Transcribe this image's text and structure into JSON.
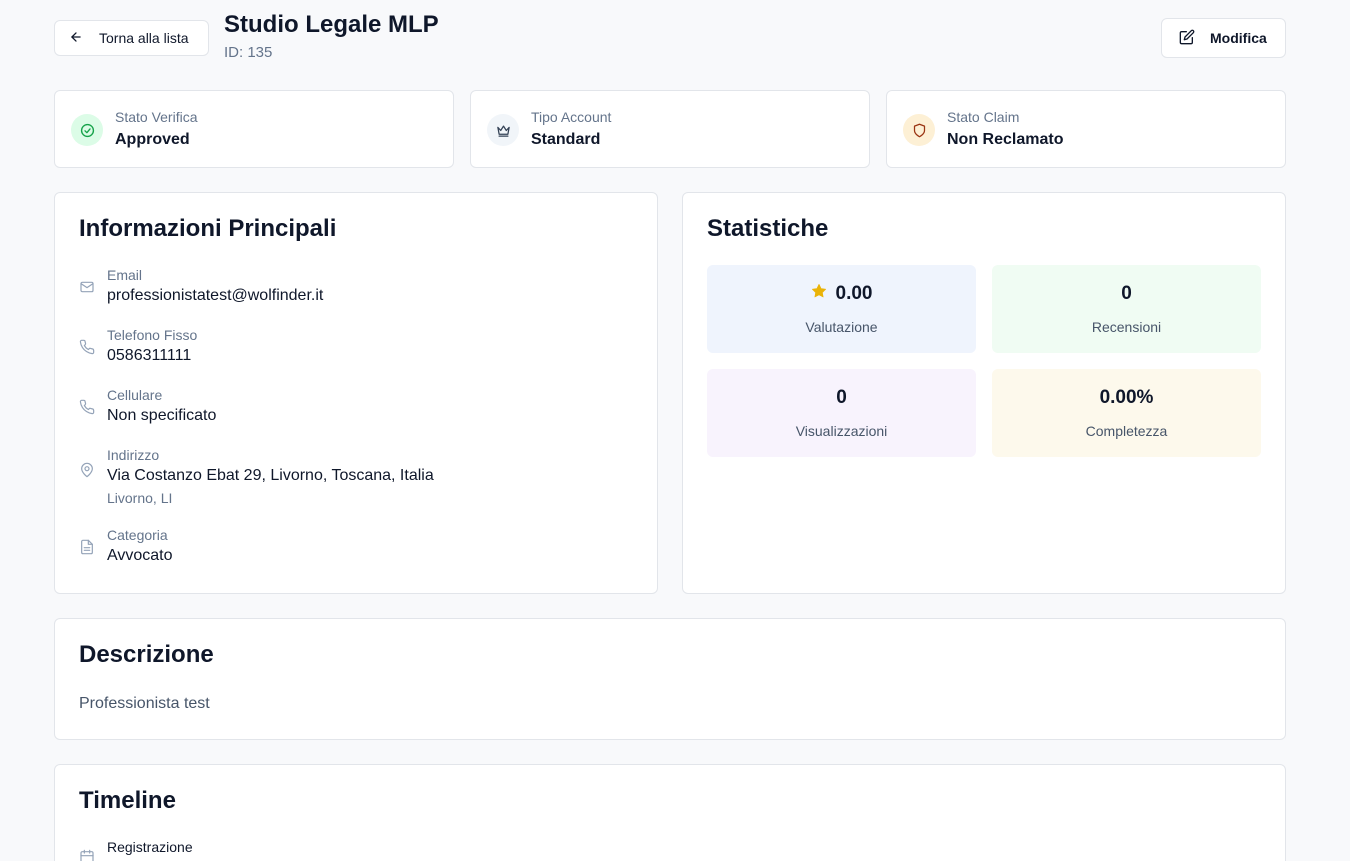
{
  "header": {
    "back_label": "Torna alla lista",
    "title": "Studio Legale MLP",
    "id_text": "ID: 135",
    "edit_label": "Modifica"
  },
  "status_cards": [
    {
      "label": "Stato Verifica",
      "value": "Approved",
      "icon": "check-circle-icon",
      "icon_bg": "#dcfce7",
      "icon_color": "#16a34a"
    },
    {
      "label": "Tipo Account",
      "value": "Standard",
      "icon": "crown-icon",
      "icon_bg": "#f1f5f9",
      "icon_color": "#334155"
    },
    {
      "label": "Stato Claim",
      "value": "Non Reclamato",
      "icon": "shield-icon",
      "icon_bg": "#fdf0d5",
      "icon_color": "#9a3412"
    }
  ],
  "info": {
    "title": "Informazioni Principali",
    "email_label": "Email",
    "email_value": "professionistatest@wolfinder.it",
    "phone_label": "Telefono Fisso",
    "phone_value": "0586311111",
    "mobile_label": "Cellulare",
    "mobile_value": "Non specificato",
    "address_label": "Indirizzo",
    "address_value": "Via Costanzo Ebat 29, Livorno, Toscana, Italia",
    "address_sub": "Livorno, LI",
    "category_label": "Categoria",
    "category_value": "Avvocato"
  },
  "stats": {
    "title": "Statistiche",
    "rating_value": "0.00",
    "rating_label": "Valutazione",
    "reviews_value": "0",
    "reviews_label": "Recensioni",
    "views_value": "0",
    "views_label": "Visualizzazioni",
    "completeness_value": "0.00%",
    "completeness_label": "Completezza"
  },
  "description": {
    "title": "Descrizione",
    "text": "Professionista test"
  },
  "timeline": {
    "title": "Timeline",
    "item_label": "Registrazione"
  },
  "colors": {
    "rating_bg": "#eff4fd",
    "reviews_bg": "#f0fcf3",
    "views_bg": "#f8f3fd",
    "completeness_bg": "#fdf9ec",
    "star": "#eab308"
  }
}
